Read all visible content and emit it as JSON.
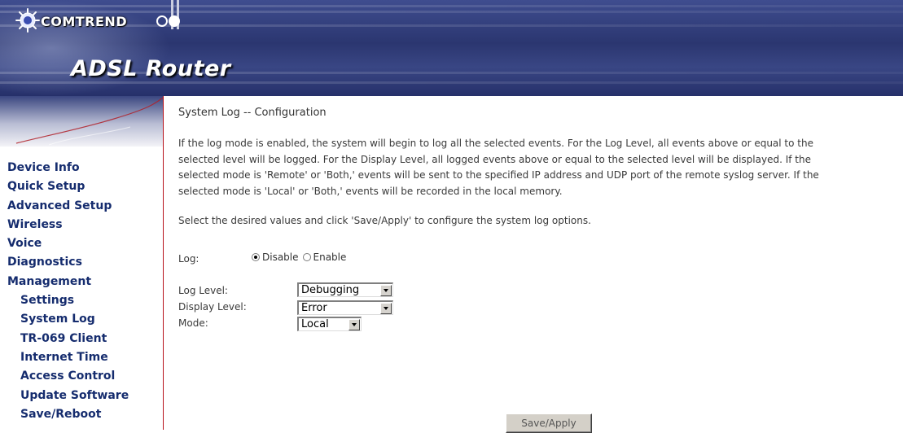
{
  "header": {
    "brand": "COMTREND",
    "product": "ADSL Router",
    "brand_color": "#2b3670",
    "divider_color": "#b7141c"
  },
  "sidebar": {
    "items": [
      {
        "label": "Device Info",
        "icon": ""
      },
      {
        "label": "Quick Setup"
      },
      {
        "label": "Advanced Setup"
      },
      {
        "label": "Wireless"
      },
      {
        "label": "Voice"
      },
      {
        "label": "Diagnostics"
      },
      {
        "label": "Management"
      }
    ],
    "subitems": [
      {
        "label": "Settings"
      },
      {
        "label": "System Log"
      },
      {
        "label": "TR-069 Client"
      },
      {
        "label": "Internet Time"
      },
      {
        "label": "Access Control"
      },
      {
        "label": "Update Software"
      },
      {
        "label": "Save/Reboot"
      }
    ]
  },
  "main": {
    "title": "System Log -- Configuration",
    "description_lines": [
      "If the log mode is enabled, the system will begin to log all the selected events. For the Log Level, all events above or equal to the",
      "selected level will be logged. For the Display Level, all logged events above or equal to the selected level will be displayed. If the",
      "selected mode is 'Remote' or 'Both,' events will be sent to the specified IP address and UDP port of the remote syslog server. If the",
      "selected mode is 'Local' or 'Both,' events will be recorded in the local memory."
    ],
    "instructions": "Select the desired values and click 'Save/Apply' to configure the system log options.",
    "log": {
      "label": "Log:",
      "disable_label": "Disable",
      "enable_label": "Enable",
      "selected": "Disable"
    },
    "log_level": {
      "label": "Log Level:",
      "value": "Debugging"
    },
    "display_level": {
      "label": "Display Level:",
      "value": "Error"
    },
    "mode": {
      "label": "Mode:",
      "value": "Local"
    },
    "save_label": "Save/Apply"
  }
}
